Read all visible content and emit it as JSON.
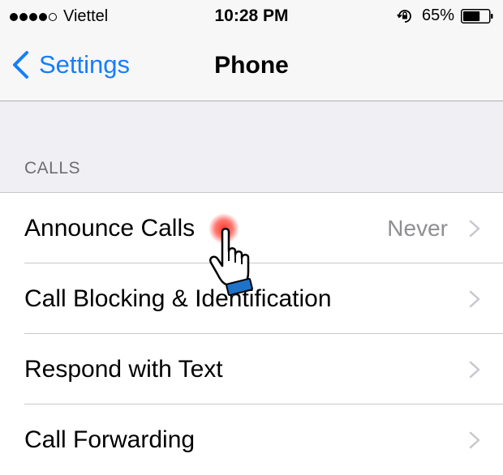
{
  "status_bar": {
    "carrier": "Viettel",
    "time": "10:28 PM",
    "battery_percent": "65%",
    "battery_level": 0.65,
    "signal_bars_filled": 4,
    "signal_bars_total": 5
  },
  "nav": {
    "back_label": "Settings",
    "title": "Phone"
  },
  "section": {
    "header": "CALLS"
  },
  "rows": [
    {
      "label": "Announce Calls",
      "value": "Never"
    },
    {
      "label": "Call Blocking & Identification",
      "value": ""
    },
    {
      "label": "Respond with Text",
      "value": ""
    },
    {
      "label": "Call Forwarding",
      "value": ""
    }
  ],
  "colors": {
    "accent": "#157efb",
    "background": "#efeff4",
    "secondary_text": "#8e8e93",
    "tap_indicator": "#ff3b30",
    "cursor_cuff": "#1e73c8"
  }
}
